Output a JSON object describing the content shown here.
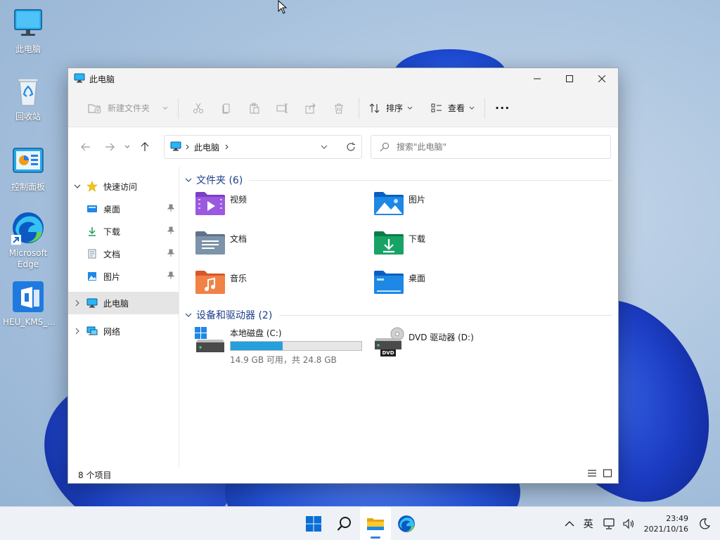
{
  "desktop": {
    "icons": [
      {
        "label": "此电脑"
      },
      {
        "label": "回收站"
      },
      {
        "label": "控制面板"
      },
      {
        "label": "Microsoft Edge"
      },
      {
        "label": "HEU_KMS_..."
      }
    ]
  },
  "window": {
    "title": "此电脑",
    "commandbar": {
      "new_folder": "新建文件夹",
      "sort": "排序",
      "view": "查看",
      "more": "···"
    },
    "address": {
      "path": "此电脑",
      "search_placeholder": "搜索\"此电脑\""
    },
    "navpane": {
      "quick_access": "快速访问",
      "items": [
        {
          "label": "桌面"
        },
        {
          "label": "下载"
        },
        {
          "label": "文档"
        },
        {
          "label": "图片"
        }
      ],
      "this_pc": "此电脑",
      "network": "网络"
    },
    "folders_header": "文件夹 (6)",
    "folders": [
      {
        "name": "视频"
      },
      {
        "name": "图片"
      },
      {
        "name": "文档"
      },
      {
        "name": "下载"
      },
      {
        "name": "音乐"
      },
      {
        "name": "桌面"
      }
    ],
    "drives_header": "设备和驱动器 (2)",
    "drives": [
      {
        "name": "本地磁盘 (C:)",
        "free_text": "14.9 GB 可用，共 24.8 GB",
        "used_fraction": 0.4
      },
      {
        "name": "DVD 驱动器 (D:)",
        "badge": "DVD"
      }
    ],
    "status": "8 个项目"
  },
  "taskbar": {
    "ime": "英",
    "time": "23:49",
    "date": "2021/10/16"
  },
  "colors": {
    "accent": "#26a0da",
    "link_header": "#1d3f8a",
    "win_blue": "#0a6fd6"
  }
}
